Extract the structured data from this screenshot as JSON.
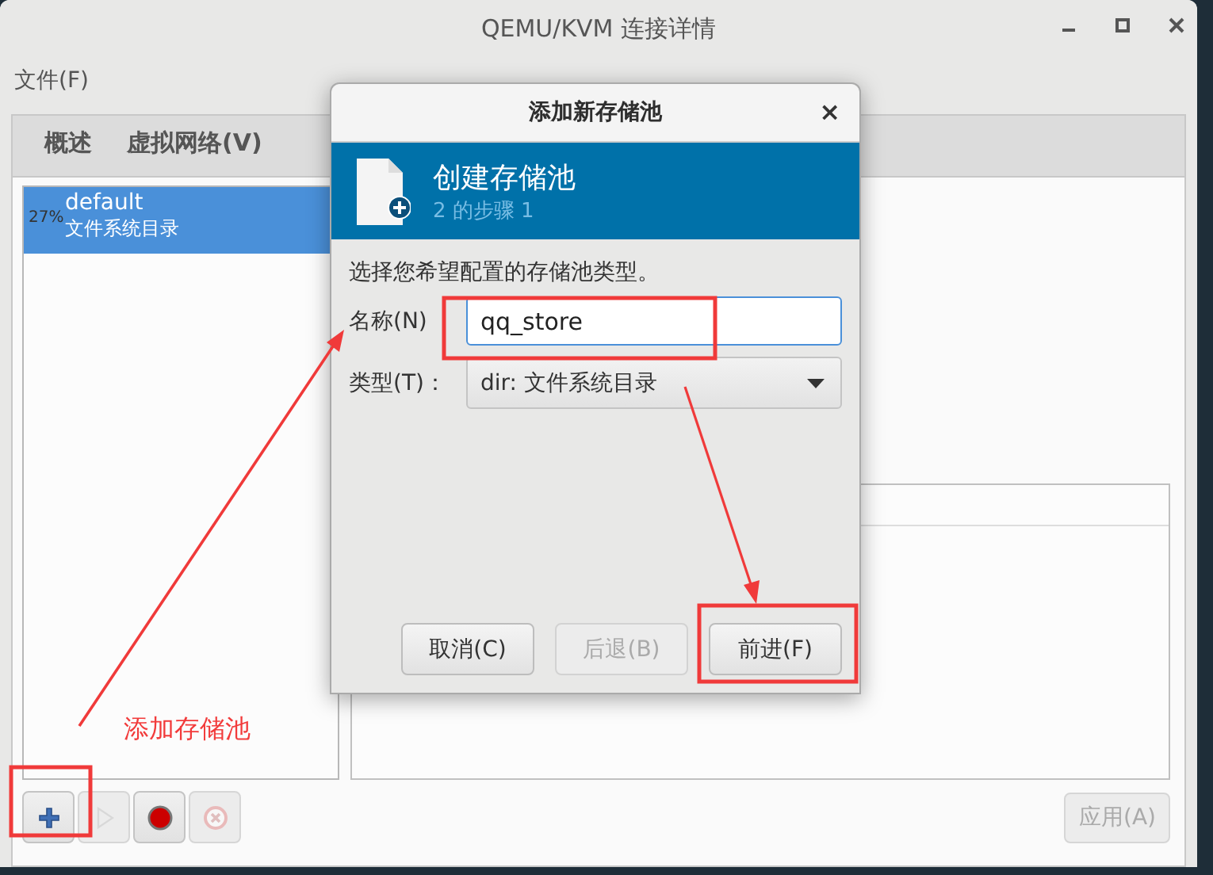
{
  "window": {
    "title": "QEMU/KVM 连接详情"
  },
  "menu": [
    {
      "label": "文件(F)"
    }
  ],
  "tabs": [
    {
      "label": "概述",
      "selected": false
    },
    {
      "label": "虚拟网络(V)",
      "selected": false
    }
  ],
  "pools": [
    {
      "usage": "27%",
      "name": "default",
      "type": "文件系统目录",
      "selected": true
    }
  ],
  "pool_toolbar": [
    {
      "kind": "add",
      "disabled": false
    },
    {
      "kind": "start",
      "disabled": true
    },
    {
      "kind": "stop",
      "disabled": false
    },
    {
      "kind": "delete",
      "disabled": true
    }
  ],
  "apply_button": {
    "label": "应用(A)",
    "disabled": true
  },
  "dialog": {
    "title": "添加新存储池",
    "close": "×",
    "banner": {
      "title": "创建存储池",
      "step": "2 的步骤 1"
    },
    "prompt": "选择您希望配置的存储池类型。",
    "fields": [
      {
        "kind": "text",
        "label": "名称(N)",
        "value": "qq_store",
        "focused": true
      },
      {
        "kind": "dropdown",
        "label": "类型(T)：",
        "value": "dir: 文件系统目录"
      }
    ],
    "buttons": [
      {
        "label": "取消(C)",
        "disabled": false
      },
      {
        "label": "后退(B)",
        "disabled": true
      },
      {
        "label": "前进(F)",
        "disabled": false
      }
    ]
  },
  "annotations": [
    {
      "kind": "label",
      "text": "添加存储池"
    }
  ]
}
